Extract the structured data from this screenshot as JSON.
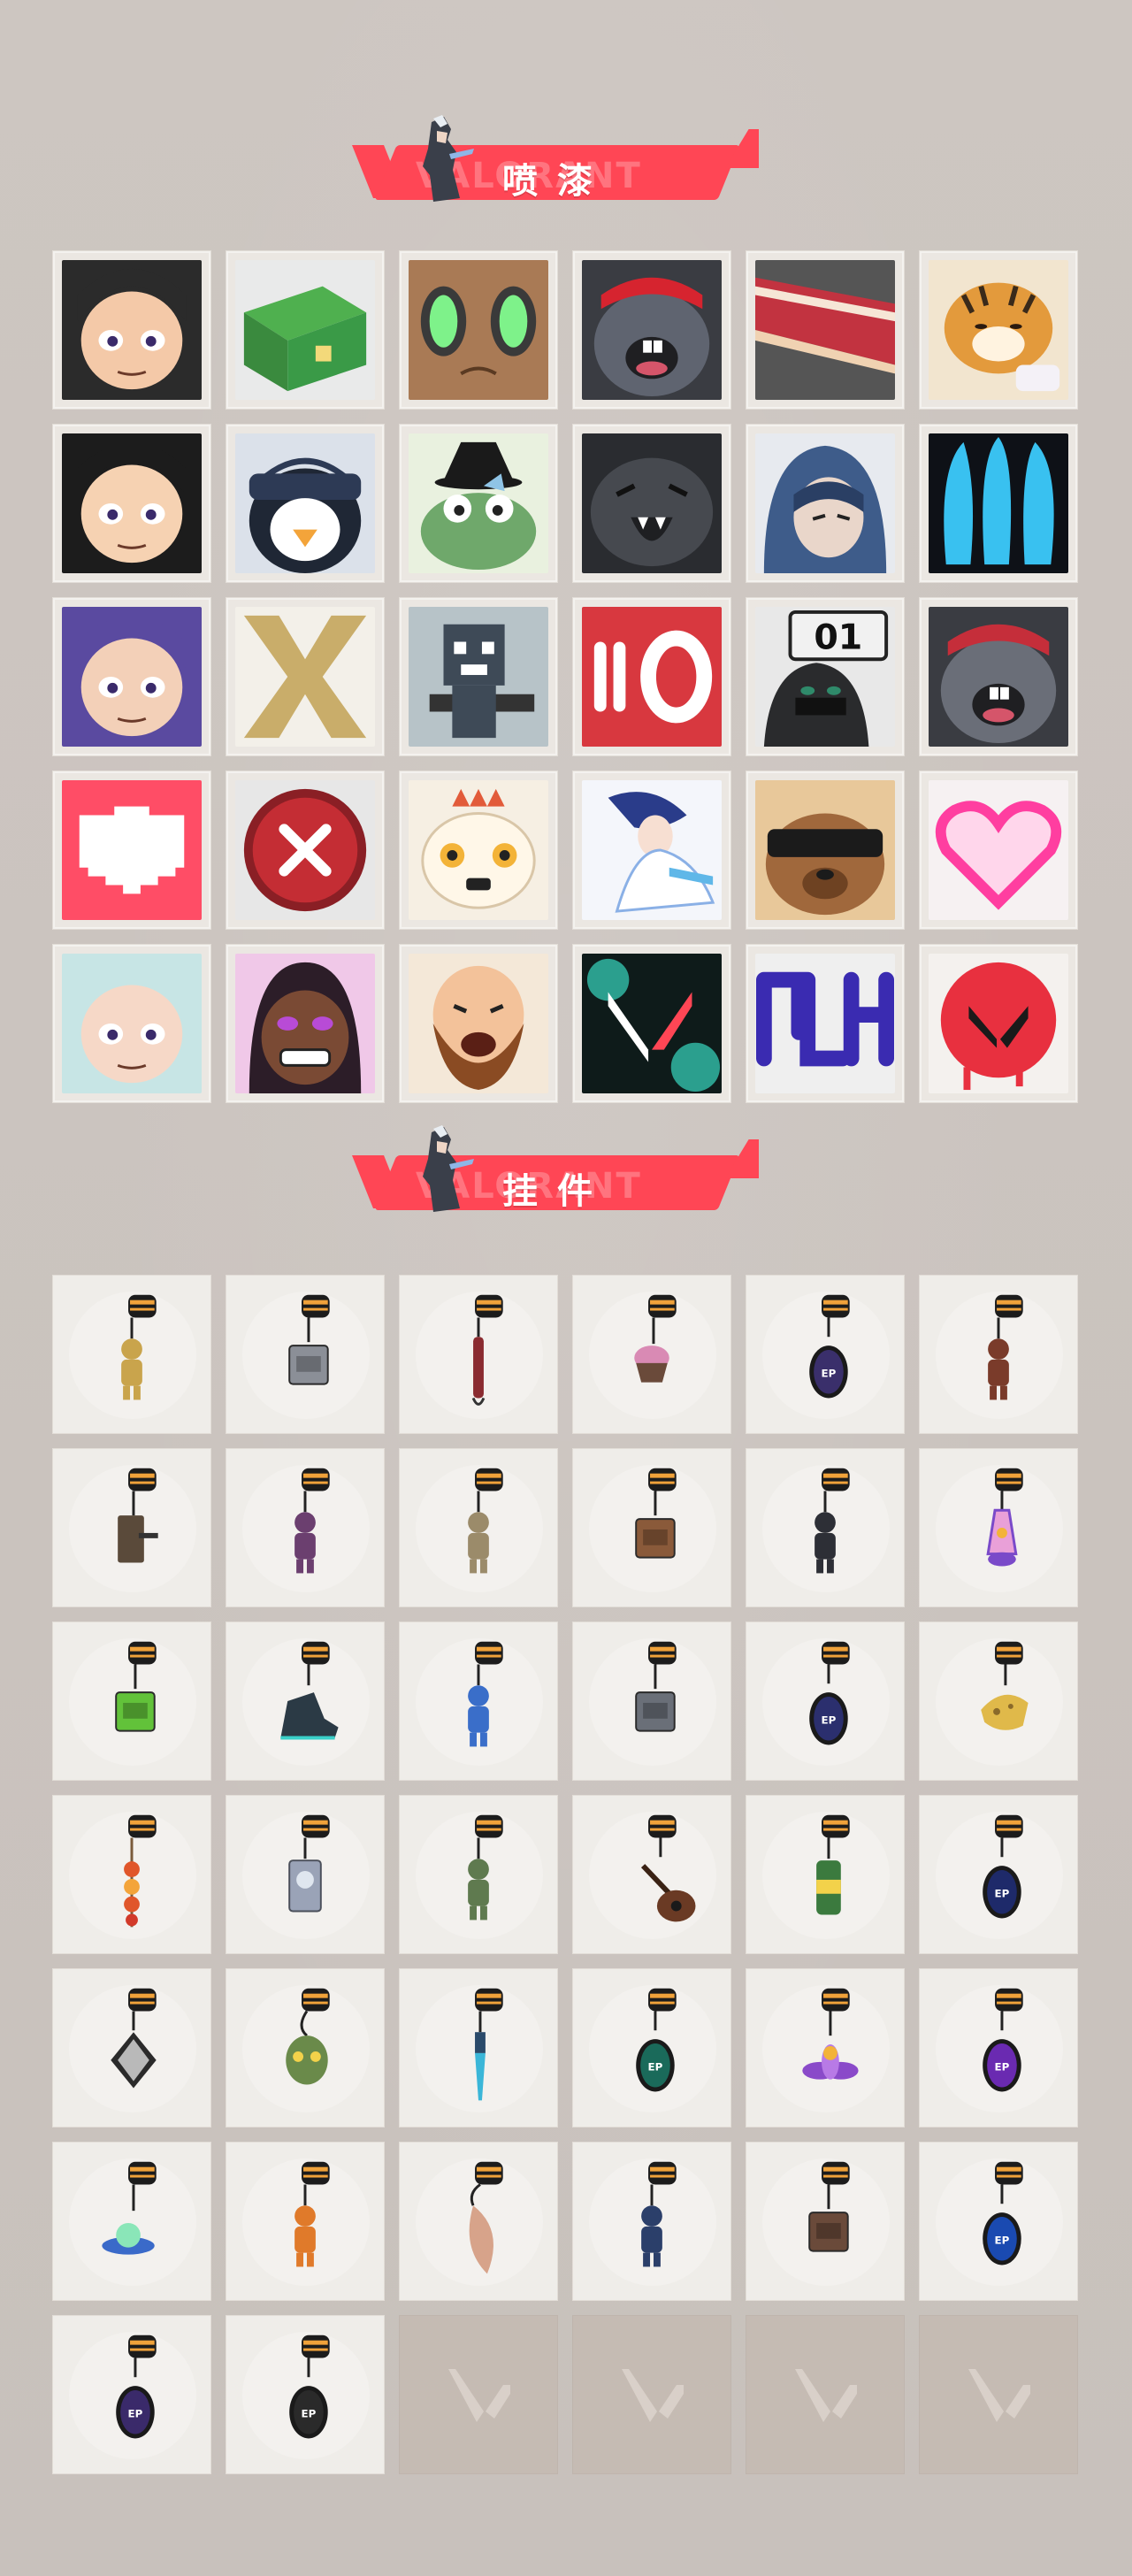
{
  "sections": {
    "sprays": {
      "title": "喷漆",
      "ghost_text": "VALORANT"
    },
    "buddies": {
      "title": "挂件",
      "ghost_text": "VALORANT"
    }
  },
  "colors": {
    "accent": "#ff4655",
    "background": "#c9c2bd",
    "card": "#efede9",
    "empty_card": "#c5bbb3"
  },
  "sprays": [
    {
      "name": "spray-sunglasses-boy",
      "art": "face",
      "bg": "#2b2b2b",
      "fg": "#f4c9a8"
    },
    {
      "name": "spray-green-box",
      "art": "box",
      "bg": "#3a9a47",
      "fg": "#f3d97a"
    },
    {
      "name": "spray-green-eyes-creature",
      "art": "eyes",
      "bg": "#a97a55",
      "fg": "#7ef28a"
    },
    {
      "name": "spray-grey-mole-red-cap",
      "art": "mole",
      "bg": "#5f6470",
      "fg": "#d6242f"
    },
    {
      "name": "spray-cake-slice",
      "art": "cake",
      "bg": "#555",
      "fg": "#c23340"
    },
    {
      "name": "spray-tiger",
      "art": "tiger",
      "bg": "#f2e5cf",
      "fg": "#e39a3c"
    },
    {
      "name": "spray-girl-pencil",
      "art": "face",
      "bg": "#1c1c1c",
      "fg": "#f6d2b2"
    },
    {
      "name": "spray-penguin-beanie",
      "art": "penguin",
      "bg": "#dbe1ea",
      "fg": "#2d3a55"
    },
    {
      "name": "spray-frog-witch-hat",
      "art": "frog",
      "bg": "#e9f1df",
      "fg": "#6fa86b"
    },
    {
      "name": "spray-grey-blob-laughing",
      "art": "blob",
      "bg": "#46494f",
      "fg": "#1e1f22"
    },
    {
      "name": "spray-hooded-agent",
      "art": "hood",
      "bg": "#3e5c8a",
      "fg": "#d7d7d7"
    },
    {
      "name": "spray-blue-claws",
      "art": "claws",
      "bg": "#0e1117",
      "fg": "#39c1f0"
    },
    {
      "name": "spray-purple-hair-girl",
      "art": "face",
      "bg": "#5a4aa0",
      "fg": "#f3d0b8"
    },
    {
      "name": "spray-gold-x-emblem",
      "art": "xmark",
      "bg": "#f3f0e9",
      "fg": "#c9ad6a"
    },
    {
      "name": "spray-pixel-raccoon-gun",
      "art": "pixel",
      "bg": "#b7c3c8",
      "fg": "#3e4a57"
    },
    {
      "name": "spray-ammo-zero",
      "art": "ammo",
      "bg": "#d8383f",
      "fg": "#ffffff"
    },
    {
      "name": "spray-01-sign-agent",
      "art": "sign",
      "bg": "#2a2b2d",
      "fg": "#f1f1f1"
    },
    {
      "name": "spray-mole-laughing",
      "art": "mole",
      "bg": "#6a6e78",
      "fg": "#c52e3a"
    },
    {
      "name": "spray-pixel-heart",
      "art": "heart",
      "bg": "#ff4d66",
      "fg": "#ffffff"
    },
    {
      "name": "spray-red-x-button",
      "art": "xbutton",
      "bg": "#e7e7e7",
      "fg": "#c42d34"
    },
    {
      "name": "spray-rooster-creature",
      "art": "rooster",
      "bg": "#f6efe3",
      "fg": "#e25b3a"
    },
    {
      "name": "spray-dancer-anime",
      "art": "dancer",
      "bg": "#f4f6fb",
      "fg": "#2a3c8a"
    },
    {
      "name": "spray-bear-sunglasses",
      "art": "bear",
      "bg": "#a0683c",
      "fg": "#1b1b1b"
    },
    {
      "name": "spray-neon-heart",
      "art": "neonheart",
      "bg": "#f6f1f2",
      "fg": "#ff3ea0"
    },
    {
      "name": "spray-silver-hair-girl",
      "art": "face",
      "bg": "#c7e5e5",
      "fg": "#f6d8c7"
    },
    {
      "name": "spray-grinning-agent",
      "art": "grin",
      "bg": "#2c1d28",
      "fg": "#b84bd6"
    },
    {
      "name": "spray-bearded-man",
      "art": "beard",
      "bg": "#f4e8d8",
      "fg": "#8a4b23"
    },
    {
      "name": "spray-valorant-logo-splash",
      "art": "vlogo",
      "bg": "#0e1b1a",
      "fg": "#38d7c0"
    },
    {
      "name": "spray-graffiti-tag",
      "art": "graffiti",
      "bg": "#efefef",
      "fg": "#3a2bb1"
    },
    {
      "name": "spray-red-v-drip",
      "art": "reddrip",
      "bg": "#f4f1ee",
      "fg": "#e8303f"
    }
  ],
  "buddies": [
    {
      "name": "buddy-gold-tiger",
      "shape": "figure",
      "color": "#c9a44c"
    },
    {
      "name": "buddy-trash-bin",
      "shape": "box",
      "color": "#8b8f97"
    },
    {
      "name": "buddy-rope-chain",
      "shape": "rope",
      "color": "#8a2b30"
    },
    {
      "name": "buddy-cupcake",
      "shape": "cupcake",
      "color": "#d98ab4"
    },
    {
      "name": "buddy-ep9-disc",
      "shape": "disc",
      "color": "#3a2f6b"
    },
    {
      "name": "buddy-bear-bell",
      "shape": "figure",
      "color": "#7a3b2a"
    },
    {
      "name": "buddy-rifle-part",
      "shape": "tool",
      "color": "#5a4a3a"
    },
    {
      "name": "buddy-agent-figure",
      "shape": "figure",
      "color": "#6b3f6f"
    },
    {
      "name": "buddy-cowboy-figure",
      "shape": "figure",
      "color": "#9b8b6a"
    },
    {
      "name": "buddy-wooden-crate",
      "shape": "box",
      "color": "#8a5a3a"
    },
    {
      "name": "buddy-robot-hat",
      "shape": "figure",
      "color": "#2d2f36"
    },
    {
      "name": "buddy-lava-lamp",
      "shape": "lamp",
      "color": "#7a4ac9"
    },
    {
      "name": "buddy-green-radio",
      "shape": "box",
      "color": "#62c23a"
    },
    {
      "name": "buddy-sneaker",
      "shape": "shoe",
      "color": "#2b3a45"
    },
    {
      "name": "buddy-astronaut",
      "shape": "figure",
      "color": "#3a6ec9"
    },
    {
      "name": "buddy-speaker",
      "shape": "box",
      "color": "#6a6f78"
    },
    {
      "name": "buddy-ep9-disc-2",
      "shape": "disc",
      "color": "#2b2f6e"
    },
    {
      "name": "buddy-cheese-slice",
      "shape": "cheese",
      "color": "#e0b94a"
    },
    {
      "name": "buddy-fire-skewer",
      "shape": "skewer",
      "color": "#e0562a"
    },
    {
      "name": "buddy-agent-card",
      "shape": "card",
      "color": "#9aa3b7"
    },
    {
      "name": "buddy-green-stamp",
      "shape": "figure",
      "color": "#5f7a4f"
    },
    {
      "name": "buddy-lute",
      "shape": "lute",
      "color": "#6a3a24"
    },
    {
      "name": "buddy-green-can",
      "shape": "can",
      "color": "#3b7a3e"
    },
    {
      "name": "buddy-ep9-disc-3",
      "shape": "disc",
      "color": "#1e2a6a"
    },
    {
      "name": "buddy-diamond-tag",
      "shape": "diamond",
      "color": "#b9b9b9"
    },
    {
      "name": "buddy-green-mask",
      "shape": "mask",
      "color": "#6a8a4a"
    },
    {
      "name": "buddy-blue-blade",
      "shape": "blade",
      "color": "#3ab6d8"
    },
    {
      "name": "buddy-ep8-disc",
      "shape": "disc",
      "color": "#1a6a5a"
    },
    {
      "name": "buddy-purple-flower",
      "shape": "flower",
      "color": "#8a4ac9"
    },
    {
      "name": "buddy-ep8-disc-2",
      "shape": "disc",
      "color": "#6a2ab1"
    },
    {
      "name": "buddy-ufo",
      "shape": "ufo",
      "color": "#3a6ac9"
    },
    {
      "name": "buddy-orange-cat",
      "shape": "figure",
      "color": "#e07a2a"
    },
    {
      "name": "buddy-fish-feather",
      "shape": "feather",
      "color": "#d7a38a"
    },
    {
      "name": "buddy-blue-figure",
      "shape": "figure",
      "color": "#2b3f6a"
    },
    {
      "name": "buddy-portal-cube",
      "shape": "box",
      "color": "#6a4a3a"
    },
    {
      "name": "buddy-ep8-disc-3",
      "shape": "disc",
      "color": "#1a4ab1"
    },
    {
      "name": "buddy-ep7-disc",
      "shape": "disc",
      "color": "#3a2a6a"
    },
    {
      "name": "buddy-v-disc",
      "shape": "disc",
      "color": "#2a2a2a"
    },
    {
      "name": "buddy-empty-1",
      "shape": "empty",
      "color": ""
    },
    {
      "name": "buddy-empty-2",
      "shape": "empty",
      "color": ""
    },
    {
      "name": "buddy-empty-3",
      "shape": "empty",
      "color": ""
    },
    {
      "name": "buddy-empty-4",
      "shape": "empty",
      "color": ""
    }
  ]
}
